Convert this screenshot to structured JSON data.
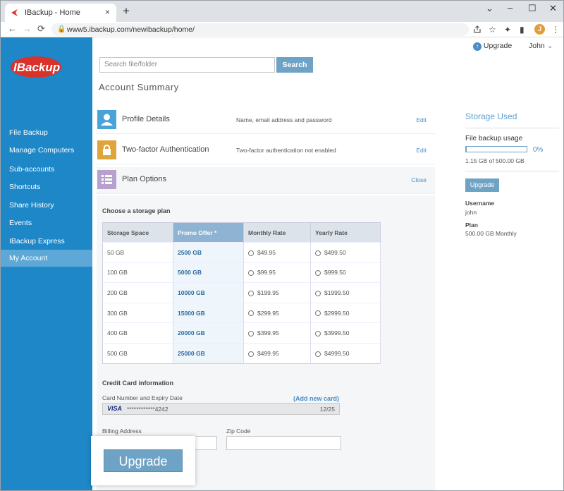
{
  "browser": {
    "tab_title": "IBackup - Home",
    "tab_close": "×",
    "new_tab": "+",
    "url": "www5.ibackup.com/newibackup/home/",
    "profile_initial": "J",
    "controls": {
      "minimize": "⌄",
      "min": "–",
      "max": "☐",
      "close": "✕"
    },
    "nav": {
      "back": "←",
      "forward": "→",
      "reload": "⟳"
    }
  },
  "sidebar": {
    "logo_text": "IBackup",
    "items": [
      {
        "label": "File Backup"
      },
      {
        "label": "Manage Computers"
      },
      {
        "label": "Sub-accounts"
      },
      {
        "label": "Shortcuts"
      },
      {
        "label": "Share History"
      },
      {
        "label": "Events"
      },
      {
        "label": "IBackup Express"
      },
      {
        "label": "My Account",
        "active": true
      }
    ]
  },
  "header": {
    "upgrade_label": "Upgrade",
    "user_name": "John",
    "search_placeholder": "Search file/folder",
    "search_button": "Search",
    "page_title": "Account Summary"
  },
  "sections": {
    "profile": {
      "title": "Profile Details",
      "desc": "Name, email address and password",
      "action": "Edit"
    },
    "twofa": {
      "title": "Two-factor Authentication",
      "desc": "Two-factor authentication not enabled",
      "action": "Edit"
    },
    "plan": {
      "title": "Plan Options",
      "action": "Close"
    }
  },
  "plan_table": {
    "heading": "Choose a storage plan",
    "columns": [
      "Storage Space",
      "Promo Offer *",
      "Monthly Rate",
      "Yearly Rate"
    ],
    "rows": [
      [
        "50 GB",
        "2500 GB",
        "$49.95",
        "$499.50"
      ],
      [
        "100 GB",
        "5000 GB",
        "$99.95",
        "$999.50"
      ],
      [
        "200 GB",
        "10000 GB",
        "$199.95",
        "$1999.50"
      ],
      [
        "300 GB",
        "15000 GB",
        "$299.95",
        "$2999.50"
      ],
      [
        "400 GB",
        "20000 GB",
        "$399.95",
        "$3999.50"
      ],
      [
        "500 GB",
        "25000 GB",
        "$499.95",
        "$4999.50"
      ]
    ]
  },
  "credit_card": {
    "heading": "Credit Card information",
    "number_label": "Card Number and Expiry Date",
    "add_card": "(Add new card)",
    "brand": "VISA",
    "masked_number": "************4242",
    "expiry": "12/25",
    "billing_label": "Billing Address",
    "zip_label": "Zip Code"
  },
  "upgrade_button": "Upgrade",
  "storage": {
    "title": "Storage Used",
    "usage_label": "File backup usage",
    "percent": "0%",
    "used_fraction": 0.0023,
    "detail": "1.15 GB of 500.00 GB",
    "upgrade_button": "Upgrade",
    "username_label": "Username",
    "username": "john",
    "plan_label": "Plan",
    "plan": "500.00 GB Monthly"
  },
  "colors": {
    "sidebar": "#1e87c8",
    "accent": "#6fa3c6",
    "link": "#4c8cc4"
  }
}
